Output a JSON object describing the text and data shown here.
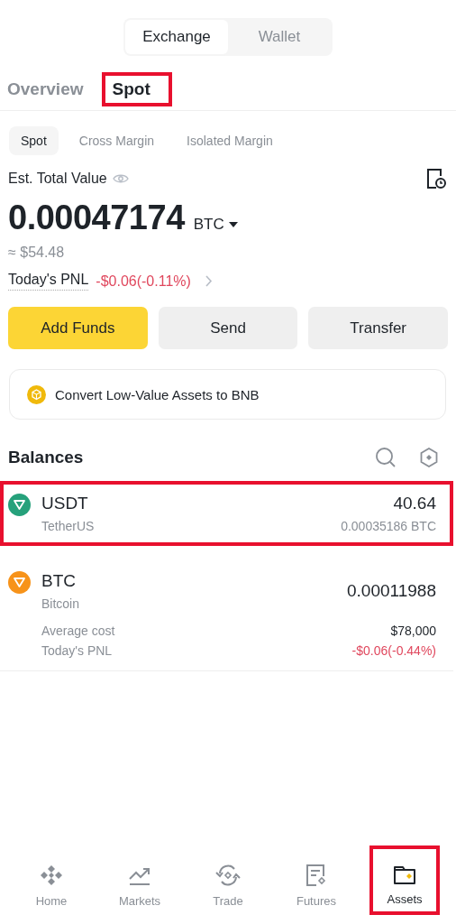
{
  "segments": [
    {
      "label": "Exchange",
      "selected": true
    },
    {
      "label": "Wallet",
      "selected": false
    }
  ],
  "tabs": [
    {
      "label": "Overview",
      "selected": false,
      "highlighted": false
    },
    {
      "label": "Spot",
      "selected": true,
      "highlighted": true
    }
  ],
  "sub_tabs": [
    {
      "label": "Spot",
      "selected": true
    },
    {
      "label": "Cross Margin",
      "selected": false
    },
    {
      "label": "Isolated Margin",
      "selected": false
    }
  ],
  "total": {
    "label": "Est. Total Value",
    "value": "0.00047174",
    "unit": "BTC",
    "approx": "≈ $54.48",
    "pnl_label": "Today's PNL",
    "pnl_value": "-$0.06(-0.11%)"
  },
  "actions": [
    {
      "label": "Add Funds",
      "kind": "primary"
    },
    {
      "label": "Send",
      "kind": "secondary"
    },
    {
      "label": "Transfer",
      "kind": "secondary"
    }
  ],
  "convert_banner": {
    "text": "Convert Low-Value Assets to BNB"
  },
  "balances": {
    "title": "Balances",
    "assets": [
      {
        "symbol": "USDT",
        "name": "TetherUS",
        "amount": "40.64",
        "btc_value": "0.00035186 BTC",
        "color": "#26a17b",
        "highlighted": true
      },
      {
        "symbol": "BTC",
        "name": "Bitcoin",
        "amount": "0.00011988",
        "color": "#f7931a",
        "highlighted": false,
        "details": [
          {
            "label": "Average cost",
            "value": "$78,000",
            "kind": "plain"
          },
          {
            "label": "Today's PNL",
            "value": "-$0.06(-0.44%)",
            "kind": "loss"
          }
        ]
      }
    ]
  },
  "nav": [
    {
      "label": "Home",
      "kind": "home",
      "selected": false,
      "highlighted": false
    },
    {
      "label": "Markets",
      "kind": "markets",
      "selected": false,
      "highlighted": false
    },
    {
      "label": "Trade",
      "kind": "trade",
      "selected": false,
      "highlighted": false
    },
    {
      "label": "Futures",
      "kind": "futures",
      "selected": false,
      "highlighted": false
    },
    {
      "label": "Assets",
      "kind": "assets",
      "selected": true,
      "highlighted": true
    }
  ]
}
